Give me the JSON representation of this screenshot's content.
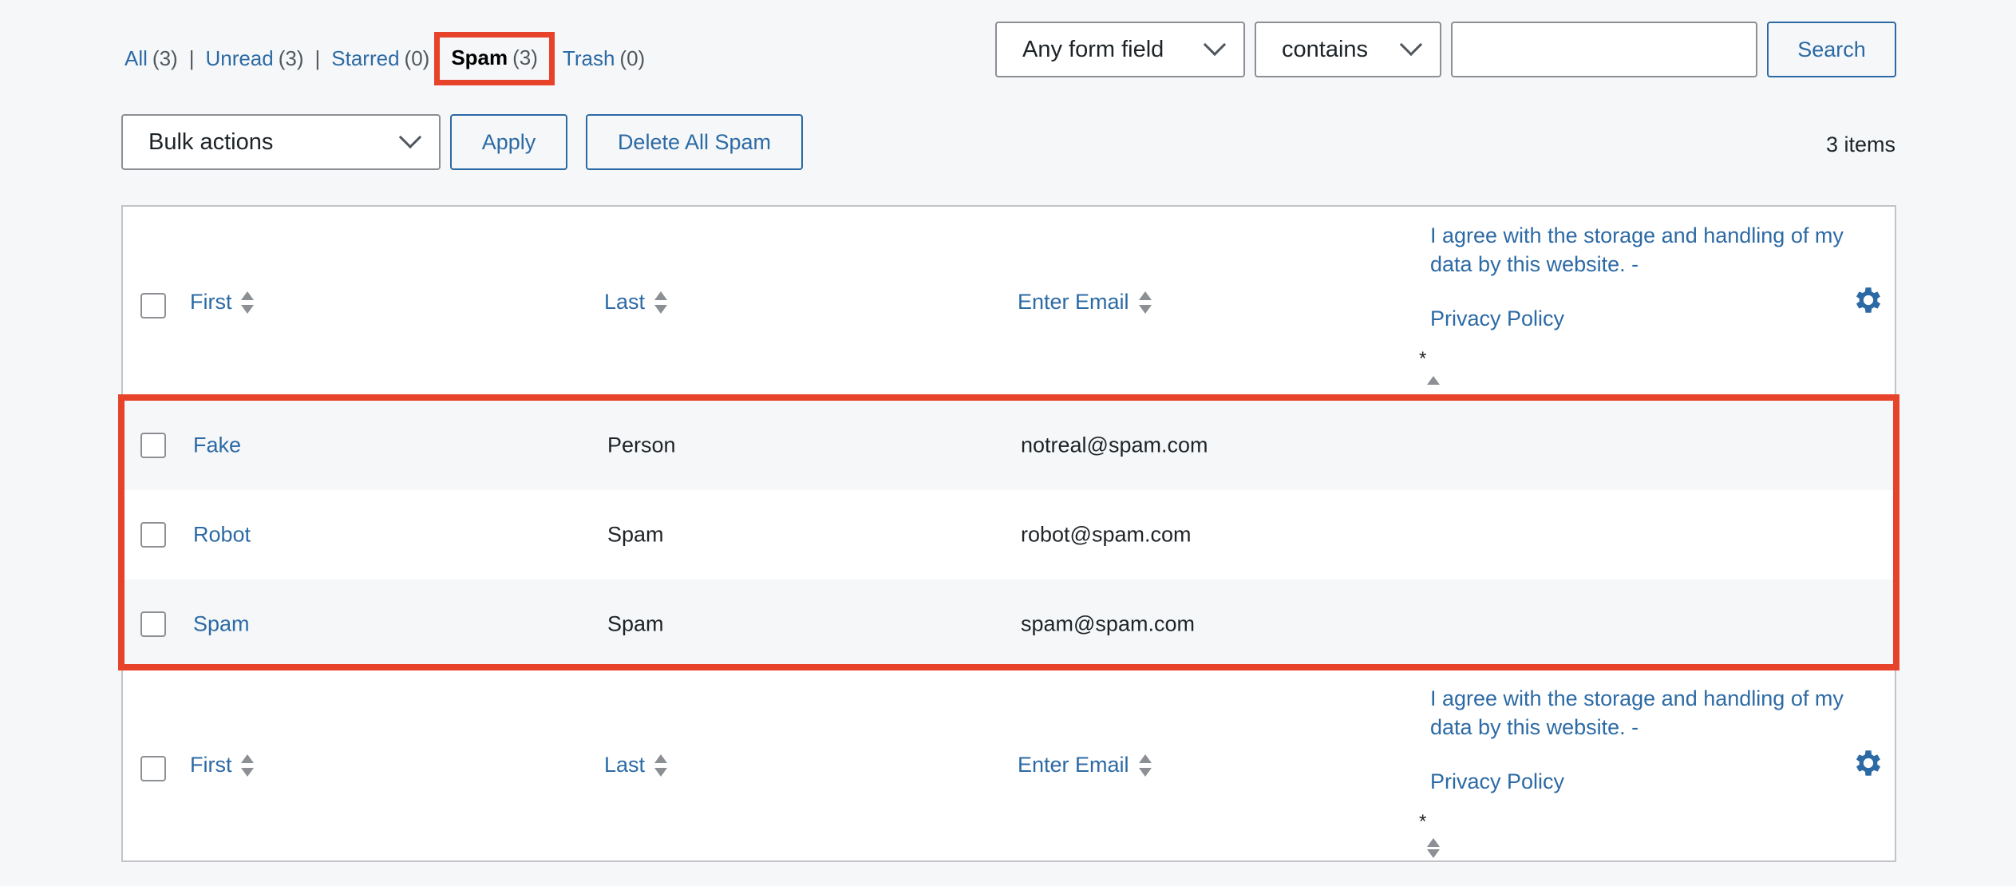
{
  "filters": {
    "all": {
      "label": "All",
      "count": "(3)"
    },
    "unread": {
      "label": "Unread",
      "count": "(3)"
    },
    "starred": {
      "label": "Starred",
      "count": "(0)"
    },
    "spam": {
      "label": "Spam",
      "count": "(3)"
    },
    "trash": {
      "label": "Trash",
      "count": "(0)"
    },
    "separator": "|"
  },
  "search": {
    "field_select": "Any form field",
    "operator_select": "contains",
    "value": "",
    "button": "Search"
  },
  "bulk": {
    "select": "Bulk actions",
    "apply": "Apply",
    "delete_all": "Delete All Spam"
  },
  "items_count": "3 items",
  "columns": {
    "first": "First",
    "last": "Last",
    "email": "Enter Email",
    "consent_line1": "I agree with the storage and handling of my data by this website. -",
    "consent_line2": "Privacy Policy",
    "required_mark": "*"
  },
  "rows": [
    {
      "first": "Fake",
      "last": "Person",
      "email": "notreal@spam.com"
    },
    {
      "first": "Robot",
      "last": "Spam",
      "email": "robot@spam.com"
    },
    {
      "first": "Spam",
      "last": "Spam",
      "email": "spam@spam.com"
    }
  ],
  "colors": {
    "link": "#2c6aa5",
    "highlight": "#e6432a",
    "border": "#c3c4c7"
  },
  "icons": {
    "settings": "gear-icon",
    "sort": "sort-arrows-icon",
    "dropdown": "chevron-down-icon"
  }
}
